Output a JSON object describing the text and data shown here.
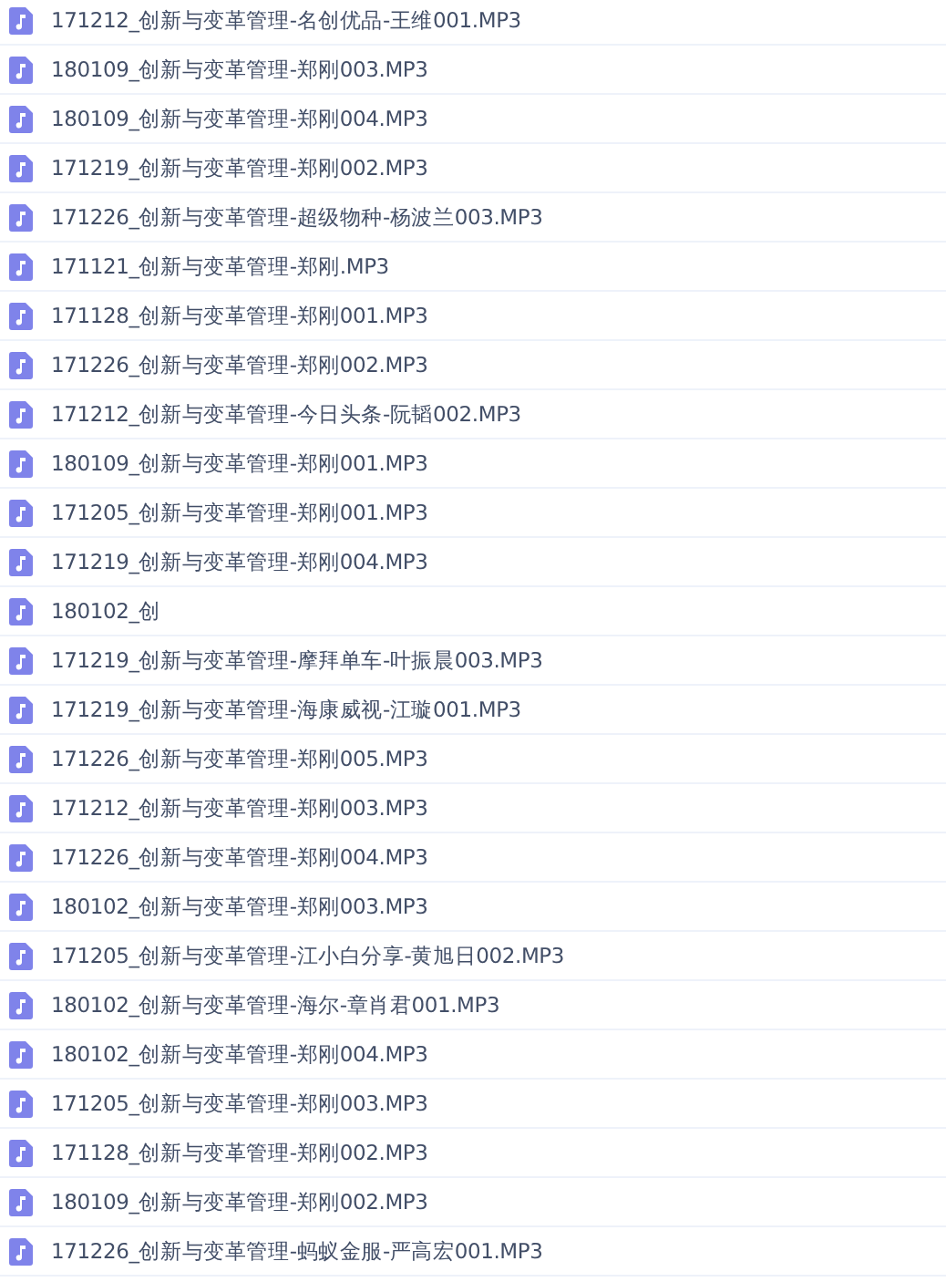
{
  "files": [
    {
      "name": "171212_创新与变革管理-名创优品-王维001.MP3"
    },
    {
      "name": "180109_创新与变革管理-郑刚003.MP3"
    },
    {
      "name": "180109_创新与变革管理-郑刚004.MP3"
    },
    {
      "name": "171219_创新与变革管理-郑刚002.MP3"
    },
    {
      "name": "171226_创新与变革管理-超级物种-杨波兰003.MP3"
    },
    {
      "name": "171121_创新与变革管理-郑刚.MP3"
    },
    {
      "name": "171128_创新与变革管理-郑刚001.MP3"
    },
    {
      "name": "171226_创新与变革管理-郑刚002.MP3"
    },
    {
      "name": "171212_创新与变革管理-今日头条-阮韬002.MP3"
    },
    {
      "name": "180109_创新与变革管理-郑刚001.MP3"
    },
    {
      "name": "171205_创新与变革管理-郑刚001.MP3"
    },
    {
      "name": "171219_创新与变革管理-郑刚004.MP3"
    },
    {
      "name": "180102_创"
    },
    {
      "name": "171219_创新与变革管理-摩拜单车-叶振晨003.MP3"
    },
    {
      "name": "171219_创新与变革管理-海康威视-江璇001.MP3"
    },
    {
      "name": "171226_创新与变革管理-郑刚005.MP3"
    },
    {
      "name": "171212_创新与变革管理-郑刚003.MP3"
    },
    {
      "name": "171226_创新与变革管理-郑刚004.MP3"
    },
    {
      "name": "180102_创新与变革管理-郑刚003.MP3"
    },
    {
      "name": "171205_创新与变革管理-江小白分享-黄旭日002.MP3"
    },
    {
      "name": "180102_创新与变革管理-海尔-章肖君001.MP3"
    },
    {
      "name": "180102_创新与变革管理-郑刚004.MP3"
    },
    {
      "name": "171205_创新与变革管理-郑刚003.MP3"
    },
    {
      "name": "171128_创新与变革管理-郑刚002.MP3"
    },
    {
      "name": "180109_创新与变革管理-郑刚002.MP3"
    },
    {
      "name": "171226_创新与变革管理-蚂蚁金服-严高宏001.MP3"
    }
  ]
}
